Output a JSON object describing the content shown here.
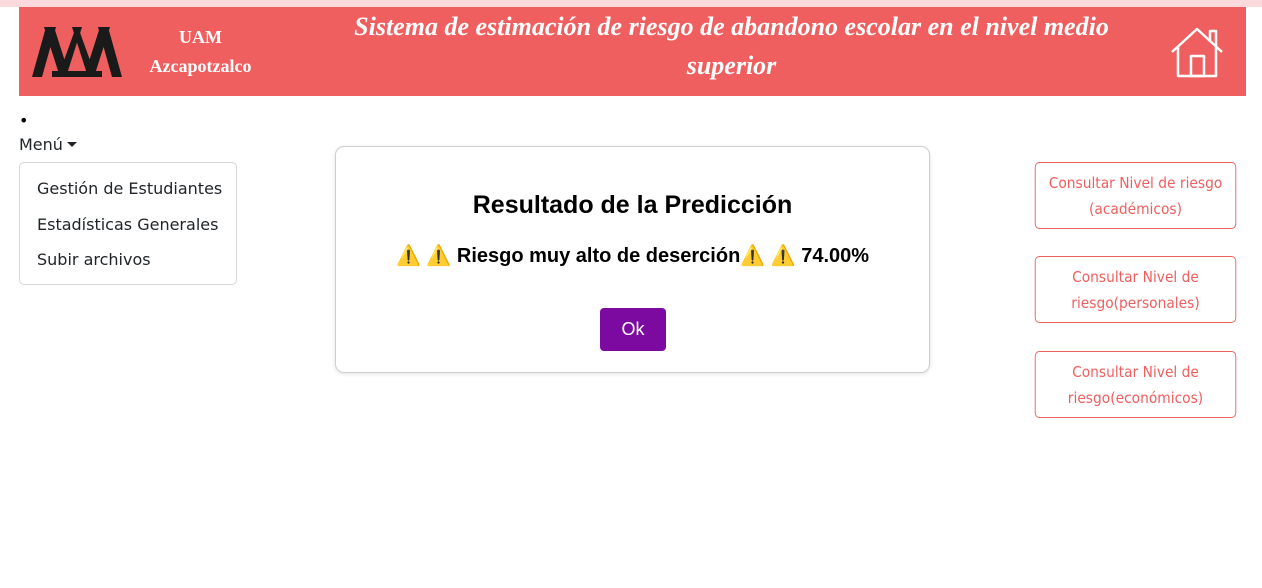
{
  "header": {
    "org_line1": "UAM",
    "org_line2": "Azcapotzalco",
    "title": "Sistema de estimación de riesgo de abandono escolar en el nivel medio superior",
    "logo_icon": "uam-logo-icon",
    "home_icon": "home-icon",
    "background_color": "#f05f5f"
  },
  "nav": {
    "bullet": "•",
    "menu_label": "Menú",
    "menu_items": [
      {
        "label": "Gestión de Estudiantes"
      },
      {
        "label": "Estadísticas Generales"
      },
      {
        "label": "Subir archivos"
      }
    ]
  },
  "modal": {
    "title": "Resultado de la Predicción",
    "message": "⚠️ ⚠️ Riesgo muy alto de deserción⚠️ ⚠️ 74.00%",
    "ok_label": "Ok",
    "ok_color": "#7c0aa0"
  },
  "side_buttons": [
    {
      "label": "Consultar Nivel de riesgo (académicos)"
    },
    {
      "label": "Consultar Nivel de riesgo(personales)"
    },
    {
      "label": "Consultar Nivel de riesgo(económicos)"
    }
  ]
}
